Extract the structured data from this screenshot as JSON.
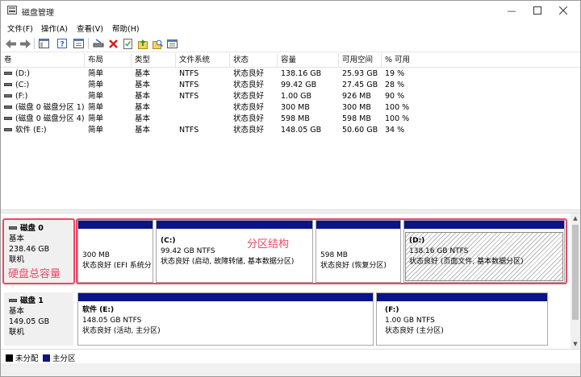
{
  "window": {
    "title": "磁盘管理"
  },
  "menu": [
    "文件(F)",
    "操作(A)",
    "查看(V)",
    "帮助(H)"
  ],
  "columns": [
    "卷",
    "布局",
    "类型",
    "文件系统",
    "状态",
    "容量",
    "可用空间",
    "% 可用"
  ],
  "volumes": [
    {
      "name": "(D:)",
      "layout": "简单",
      "type": "基本",
      "fs": "NTFS",
      "status": "状态良好",
      "capacity": "138.16 GB",
      "free": "25.93 GB",
      "pct": "19 %"
    },
    {
      "name": "(C:)",
      "layout": "简单",
      "type": "基本",
      "fs": "NTFS",
      "status": "状态良好",
      "capacity": "99.42 GB",
      "free": "27.45 GB",
      "pct": "28 %"
    },
    {
      "name": "(F:)",
      "layout": "简单",
      "type": "基本",
      "fs": "NTFS",
      "status": "状态良好",
      "capacity": "1.00 GB",
      "free": "926 MB",
      "pct": "90 %"
    },
    {
      "name": "(磁盘 0 磁盘分区 1)",
      "layout": "简单",
      "type": "基本",
      "fs": "",
      "status": "状态良好",
      "capacity": "300 MB",
      "free": "300 MB",
      "pct": "100 %"
    },
    {
      "name": "(磁盘 0 磁盘分区 4)",
      "layout": "简单",
      "type": "基本",
      "fs": "",
      "status": "状态良好",
      "capacity": "598 MB",
      "free": "598 MB",
      "pct": "100 %"
    },
    {
      "name": "软件 (E:)",
      "layout": "简单",
      "type": "基本",
      "fs": "NTFS",
      "status": "状态良好",
      "capacity": "148.05 GB",
      "free": "50.60 GB",
      "pct": "34 %"
    }
  ],
  "disks": [
    {
      "name": "磁盘 0",
      "type": "基本",
      "size": "238.46 GB",
      "state": "联机",
      "partitions": [
        {
          "label": "",
          "size": "300 MB",
          "status": "状态良好 (EFI 系统分区)"
        },
        {
          "label": "(C:)",
          "size": "99.42 GB NTFS",
          "status": "状态良好 (启动, 故障转储, 基本数据分区)"
        },
        {
          "label": "",
          "size": "598 MB",
          "status": "状态良好 (恢复分区)"
        },
        {
          "label": "(D:)",
          "size": "138.16 GB NTFS",
          "status": "状态良好 (页面文件, 基本数据分区)"
        }
      ]
    },
    {
      "name": "磁盘 1",
      "type": "基本",
      "size": "149.05 GB",
      "state": "联机",
      "partitions": [
        {
          "label": "软件  (E:)",
          "size": "148.05 GB NTFS",
          "status": "状态良好 (活动, 主分区)"
        },
        {
          "label": "(F:)",
          "size": "1.00 GB NTFS",
          "status": "状态良好 (主分区)"
        }
      ]
    }
  ],
  "annotations": {
    "total_capacity": "硬盘总容量",
    "partition_structure": "分区结构"
  },
  "legend": [
    "未分配",
    "主分区"
  ],
  "colors": {
    "primary_partition": "#0a1487",
    "unallocated": "#000000",
    "annotation": "#ee4766"
  }
}
